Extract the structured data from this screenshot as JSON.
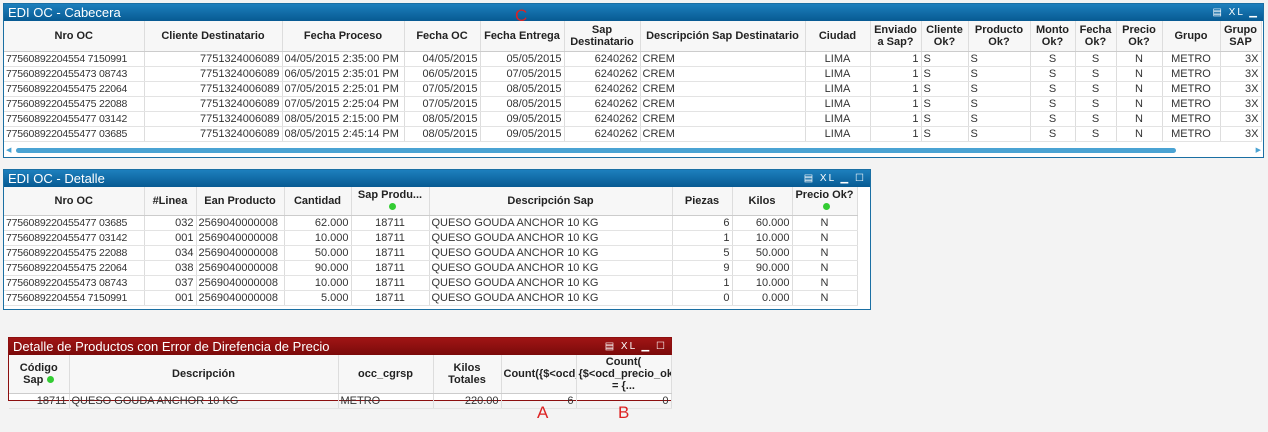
{
  "cabecera": {
    "title": "EDI OC - Cabecera",
    "controls": "▤ XL ▁",
    "columns": [
      "Nro OC",
      "Cliente Destinatario",
      "Fecha Proceso",
      "Fecha OC",
      "Fecha Entrega",
      "Sap Destinatario",
      "Descripción Sap Destinatario",
      "Ciudad",
      "Enviado a Sap?",
      "Cliente Ok?",
      "Producto Ok?",
      "Monto Ok?",
      "Fecha Ok?",
      "Precio Ok?",
      "Grupo",
      "Grupo SAP"
    ],
    "rows": [
      [
        "77560892204554 7150991",
        "7751324006089",
        "04/05/2015  2:35:00 PM",
        "04/05/2015",
        "05/05/2015",
        "6240262",
        "CREM",
        "LIMA",
        "1",
        "S",
        "S",
        "S",
        "S",
        "N",
        "METRO",
        "3X"
      ],
      [
        "7756089220455473 08743",
        "7751324006089",
        "06/05/2015  2:35:01 PM",
        "06/05/2015",
        "07/05/2015",
        "6240262",
        "CREM",
        "LIMA",
        "1",
        "S",
        "S",
        "S",
        "S",
        "N",
        "METRO",
        "3X"
      ],
      [
        "7756089220455475 22064",
        "7751324006089",
        "07/05/2015  2:25:01 PM",
        "07/05/2015",
        "08/05/2015",
        "6240262",
        "CREM",
        "LIMA",
        "1",
        "S",
        "S",
        "S",
        "S",
        "N",
        "METRO",
        "3X"
      ],
      [
        "7756089220455475 22088",
        "7751324006089",
        "07/05/2015  2:25:04 PM",
        "07/05/2015",
        "08/05/2015",
        "6240262",
        "CREM",
        "LIMA",
        "1",
        "S",
        "S",
        "S",
        "S",
        "N",
        "METRO",
        "3X"
      ],
      [
        "7756089220455477 03142",
        "7751324006089",
        "08/05/2015  2:15:00 PM",
        "08/05/2015",
        "09/05/2015",
        "6240262",
        "CREM",
        "LIMA",
        "1",
        "S",
        "S",
        "S",
        "S",
        "N",
        "METRO",
        "3X"
      ],
      [
        "7756089220455477 03685",
        "7751324006089",
        "08/05/2015  2:45:14 PM",
        "08/05/2015",
        "09/05/2015",
        "6240262",
        "CREM",
        "LIMA",
        "1",
        "S",
        "S",
        "S",
        "S",
        "N",
        "METRO",
        "3X"
      ]
    ]
  },
  "detalle": {
    "title": "EDI OC - Detalle",
    "controls": "▤ XL ▁ ☐",
    "columns": [
      "Nro OC",
      "#Linea",
      "Ean Producto",
      "Cantidad",
      "Sap Produ...",
      "Descripción Sap",
      "Piezas",
      "Kilos",
      "Precio Ok?"
    ],
    "rows": [
      [
        "7756089220455477 03685",
        "032",
        "2569040000008",
        "62.000",
        "18711",
        "QUESO GOUDA ANCHOR 10 KG",
        "6",
        "60.000",
        "N"
      ],
      [
        "7756089220455477 03142",
        "001",
        "2569040000008",
        "10.000",
        "18711",
        "QUESO GOUDA ANCHOR 10 KG",
        "1",
        "10.000",
        "N"
      ],
      [
        "7756089220455475 22088",
        "034",
        "2569040000008",
        "50.000",
        "18711",
        "QUESO GOUDA ANCHOR 10 KG",
        "5",
        "50.000",
        "N"
      ],
      [
        "7756089220455475 22064",
        "038",
        "2569040000008",
        "90.000",
        "18711",
        "QUESO GOUDA ANCHOR 10 KG",
        "9",
        "90.000",
        "N"
      ],
      [
        "7756089220455473 08743",
        "037",
        "2569040000008",
        "10.000",
        "18711",
        "QUESO GOUDA ANCHOR 10 KG",
        "1",
        "10.000",
        "N"
      ],
      [
        "77560892204554 7150991",
        "001",
        "2569040000008",
        "5.000",
        "18711",
        "QUESO GOUDA ANCHOR 10 KG",
        "0",
        "0.000",
        "N"
      ]
    ]
  },
  "error": {
    "title": "Detalle de Productos con Error de Direfencia de Precio",
    "controls": "▤ XL ▁ ☐",
    "columns": [
      "Código Sap",
      "Descripción",
      "occ_cgrsp",
      "Kilos Totales",
      "Count({$<ocd_precio_...",
      "Count( {$<ocd_precio_ok = {..."
    ],
    "rows": [
      [
        "18711",
        "QUESO GOUDA ANCHOR 10 KG",
        "METRO",
        "220.00",
        "6",
        "0"
      ]
    ]
  },
  "annotations": {
    "c": "C",
    "a": "A",
    "b": "B"
  }
}
